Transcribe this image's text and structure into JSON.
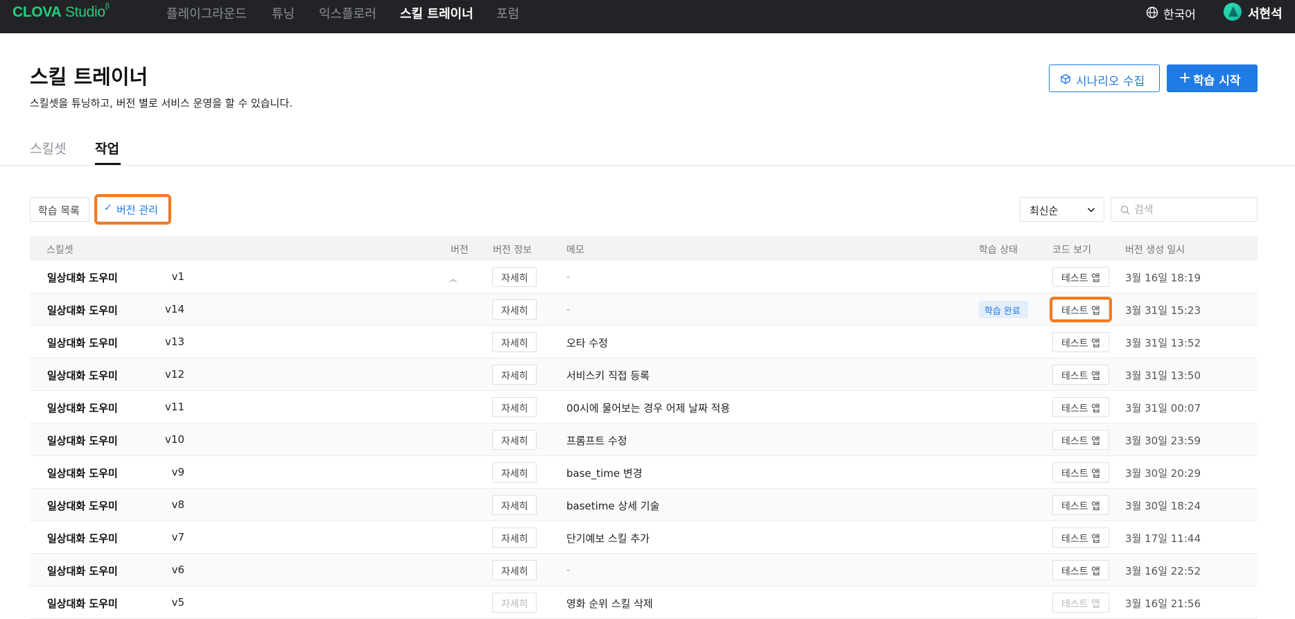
{
  "topbar": {
    "logo_main": "CLOVA",
    "logo_sub": "Studio",
    "logo_beta": "β",
    "nav": [
      "플레이그라운드",
      "튜닝",
      "익스플로러",
      "스킬 트레이너",
      "포럼"
    ],
    "active_nav": "스킬 트레이너",
    "language": "한국어",
    "user_name": "서현석",
    "accent_color": "#22d07e"
  },
  "header": {
    "title": "스킬 트레이너",
    "subtitle": "스킬셋을 튜닝하고, 버전 별로 서비스 운영을 할 수 있습니다.",
    "scenario_button": "시나리오 수집",
    "start_button": "학습 시작",
    "primary_color": "#1f7be6"
  },
  "tabs": [
    "스킬셋",
    "작업"
  ],
  "active_tab": "작업",
  "filters": {
    "list_button": "학습 목록",
    "version_button": "버전 관리",
    "sort_selected": "최신순",
    "search_placeholder": "검색"
  },
  "table": {
    "columns": {
      "skillset": "스킬셋",
      "version": "버전",
      "version_info": "버전 정보",
      "memo": "메모",
      "status": "학습 상태",
      "code": "코드 보기",
      "created": "버전 생성 일시"
    },
    "detail_label": "자세히",
    "test_label": "테스트 앱",
    "rows": [
      {
        "skillset": "일상대화 도우미",
        "version": "v1",
        "memo": "-",
        "status": "",
        "created": "3월 16일 18:19"
      },
      {
        "skillset": "일상대화 도우미",
        "version": "v14",
        "memo": "-",
        "status": "학습 완료",
        "created": "3월 31일 15:23"
      },
      {
        "skillset": "일상대화 도우미",
        "version": "v13",
        "memo": "오타 수정",
        "status": "",
        "created": "3월 31일 13:52"
      },
      {
        "skillset": "일상대화 도우미",
        "version": "v12",
        "memo": "서비스키 직접 등록",
        "status": "",
        "created": "3월 31일 13:50"
      },
      {
        "skillset": "일상대화 도우미",
        "version": "v11",
        "memo": "00시에 물어보는 경우 어제 날짜 적용",
        "status": "",
        "created": "3월 31일 00:07"
      },
      {
        "skillset": "일상대화 도우미",
        "version": "v10",
        "memo": "프롬프트 수정",
        "status": "",
        "created": "3월 30일 23:59"
      },
      {
        "skillset": "일상대화 도우미",
        "version": "v9",
        "memo": "base_time 변경",
        "status": "",
        "created": "3월 30일 20:29"
      },
      {
        "skillset": "일상대화 도우미",
        "version": "v8",
        "memo": "basetime 상세 기술",
        "status": "",
        "created": "3월 30일 18:24"
      },
      {
        "skillset": "일상대화 도우미",
        "version": "v7",
        "memo": "단기예보 스킬 추가",
        "status": "",
        "created": "3월 17일 11:44"
      },
      {
        "skillset": "일상대화 도우미",
        "version": "v6",
        "memo": "-",
        "status": "",
        "created": "3월 16일 22:52"
      },
      {
        "skillset": "일상대화 도우미",
        "version": "v5",
        "memo": "영화 순위 스킬 삭제",
        "status": "",
        "created": "3월 16일 21:56"
      }
    ]
  }
}
